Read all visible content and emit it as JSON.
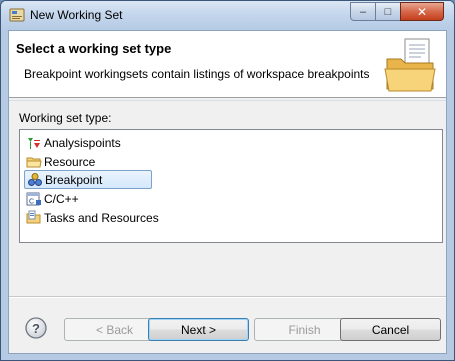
{
  "window": {
    "title": "New Working Set",
    "controls": {
      "minimize": "‒",
      "maximize": "□",
      "close": "✕"
    }
  },
  "header": {
    "title": "Select a working set type",
    "description": "Breakpoint workingsets contain listings of workspace breakpoints"
  },
  "working_set": {
    "label": "Working set type:",
    "items": [
      {
        "label": "Analysispoints",
        "icon": "analysispoints-icon"
      },
      {
        "label": "Resource",
        "icon": "resource-folder-icon"
      },
      {
        "label": "Breakpoint",
        "icon": "breakpoint-icon",
        "selected": true
      },
      {
        "label": "C/C++",
        "icon": "cpp-project-icon"
      },
      {
        "label": "Tasks and Resources",
        "icon": "tasks-resources-icon"
      }
    ]
  },
  "buttons": {
    "back": "< Back",
    "next": "Next >",
    "finish": "Finish",
    "cancel": "Cancel"
  },
  "colors": {
    "selection_fill": "#d5e8fb",
    "selection_border": "#7da2ce",
    "default_button_border": "#3c7fb1"
  }
}
